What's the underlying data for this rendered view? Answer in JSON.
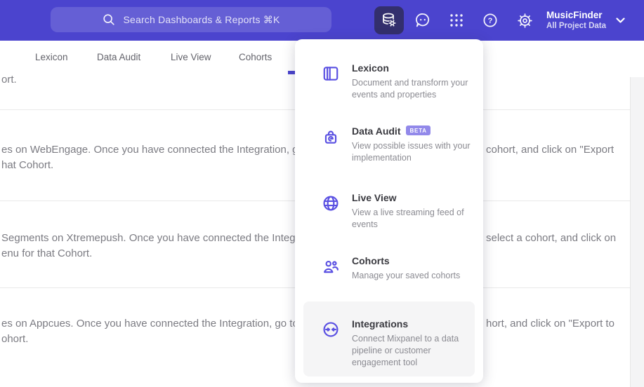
{
  "header": {
    "search": {
      "placeholder": "Search Dashboards & Reports ⌘K"
    },
    "icons": {
      "data_management": "database-gear-icon",
      "feedback": "chat-face-icon",
      "apps": "grid-dots-icon",
      "help": "question-circle-icon",
      "settings": "gear-icon"
    },
    "help_glyph": "?",
    "project": {
      "name": "MusicFinder",
      "subtitle": "All Project Data"
    }
  },
  "nav": {
    "tabs": [
      "Lexicon",
      "Data Audit",
      "Live View",
      "Cohorts"
    ]
  },
  "menu": {
    "items": [
      {
        "title": "Lexicon",
        "icon": "book-icon",
        "description": "Document and transform your events and properties"
      },
      {
        "title": "Data Audit",
        "icon": "audit-lock-icon",
        "badge": "BETA",
        "description": "View possible issues with your implementation"
      },
      {
        "title": "Live View",
        "icon": "globe-icon",
        "description": "View a live streaming feed of events"
      },
      {
        "title": "Cohorts",
        "icon": "people-icon",
        "description": "Manage your saved cohorts"
      },
      {
        "title": "Integrations",
        "icon": "sync-arrows-icon",
        "description": "Connect Mixpanel to a data pipeline or customer engagement tool",
        "highlighted": true
      }
    ]
  },
  "content": {
    "rows": [
      {
        "left1": "ort."
      },
      {
        "left1": "es on WebEngage. Once you have connected the Integration, go to the",
        "right1": "cohort, and click on \"Export",
        "left2": "hat Cohort."
      },
      {
        "left1": "Segments on Xtremepush. Once you have connected the Integration, ",
        "right1": "select a cohort, and click on",
        "left2": "enu for that Cohort."
      },
      {
        "left1": "es on Appcues. Once you have connected the Integration, go to the M",
        "right1": "hort, and click on \"Export to",
        "left2": "ohort."
      }
    ]
  },
  "colors": {
    "header_bg": "#4b44ce",
    "active_icon_bg": "#332f6d",
    "menu_icon": "#5a50e2",
    "badge_bg": "#9289ea",
    "highlight_bg": "#f5f5f6",
    "tab_indicator": "#4b44ce"
  }
}
